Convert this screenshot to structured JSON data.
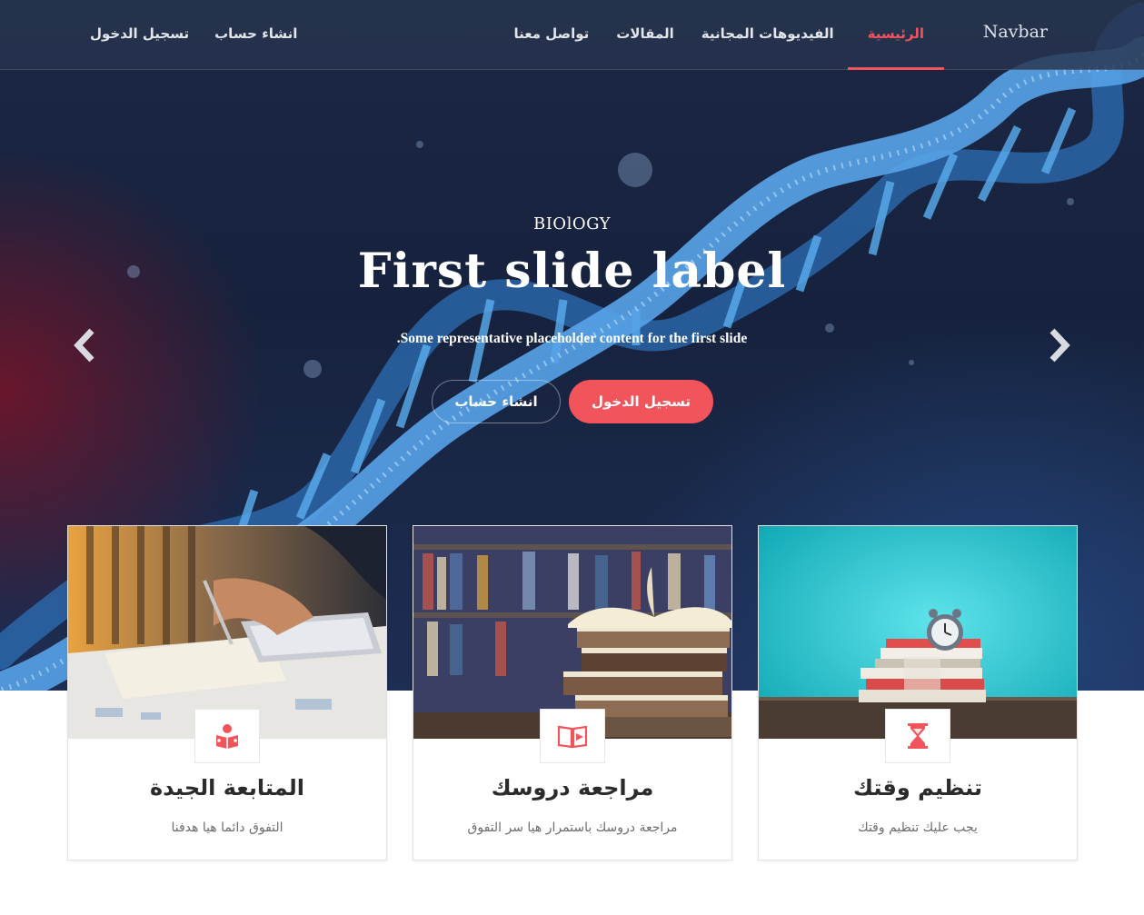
{
  "colors": {
    "accent": "#f2545b",
    "hero_background": "#16223d",
    "dna_blue": "#4aa3e8",
    "card_title": "#2b2b2b",
    "card_text": "#6d6d6d"
  },
  "navbar": {
    "brand": "Navbar",
    "links": [
      {
        "label": "الرئيسية",
        "active": true
      },
      {
        "label": "الفيديوهات المجانية",
        "active": false
      },
      {
        "label": "المقالات",
        "active": false
      },
      {
        "label": "تواصل معنا",
        "active": false
      }
    ],
    "auth": {
      "register": "انشاء حساب",
      "login": "تسجيل الدخول"
    }
  },
  "hero": {
    "subtitle": "BIOlOGY",
    "title": "First slide label",
    "description": ".Some representative placeholder content for the first slide",
    "primary_button": "تسجيل الدخول",
    "secondary_button": "انشاء حساب",
    "prev_icon": "chevron-left-icon",
    "next_icon": "chevron-right-icon"
  },
  "cards": [
    {
      "title": "المتابعة الجيدة",
      "text": "التفوق دائما هيا هدفنا",
      "icon": "reading-person-icon"
    },
    {
      "title": "مراجعة دروسك",
      "text": "مراجعة دروسك باستمرار هيا سر التفوق",
      "icon": "video-book-icon"
    },
    {
      "title": "تنظيم وقتك",
      "text": "يجب عليك تنظيم وقتك",
      "icon": "hourglass-icon"
    }
  ]
}
